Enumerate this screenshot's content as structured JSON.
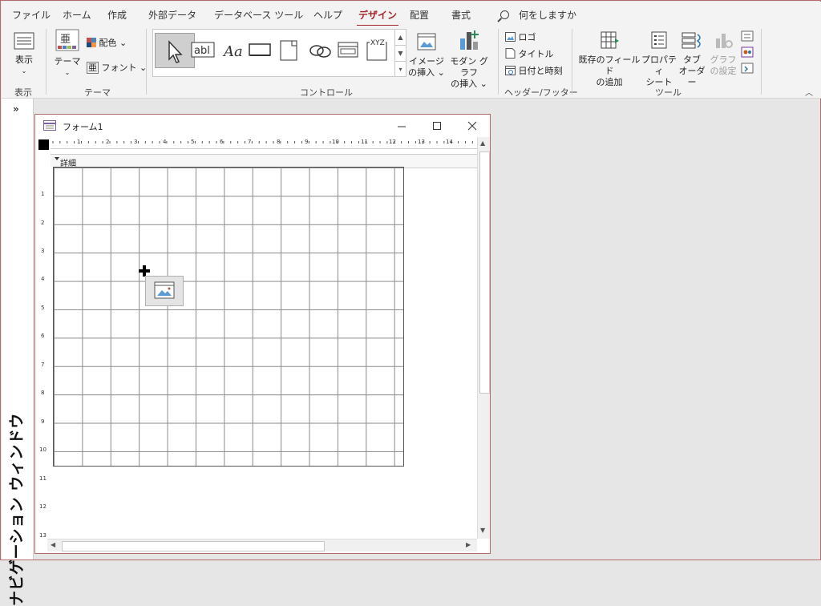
{
  "tabs": [
    {
      "id": "file",
      "label": "ファイル"
    },
    {
      "id": "home",
      "label": "ホーム"
    },
    {
      "id": "create",
      "label": "作成"
    },
    {
      "id": "external",
      "label": "外部データ"
    },
    {
      "id": "dbtools",
      "label": "データベース ツール"
    },
    {
      "id": "help",
      "label": "ヘルプ"
    },
    {
      "id": "design",
      "label": "デザイン",
      "active": true
    },
    {
      "id": "arrange",
      "label": "配置"
    },
    {
      "id": "format",
      "label": "書式"
    }
  ],
  "tell_me": "何をしますか",
  "ribbon": {
    "views": {
      "button": "表示",
      "group": "表示"
    },
    "themes": {
      "theme": "テーマ",
      "colors": "配色",
      "fonts": "フォント",
      "group": "テーマ"
    },
    "controls": {
      "group": "コントロール",
      "insert_image_1": "イメージ",
      "insert_image_2": "の挿入",
      "modern_chart_1": "モダン グラフ",
      "modern_chart_2": "の挿入"
    },
    "header_footer": {
      "logo": "ロゴ",
      "title": "タイトル",
      "datetime": "日付と時刻",
      "group": "ヘッダー/フッター"
    },
    "tools": {
      "add_fields_1": "既存のフィールド",
      "add_fields_2": "の追加",
      "property_1": "プロパティ",
      "property_2": "シート",
      "tab_order_1": "タブ",
      "tab_order_2": "オーダー",
      "chart_settings_1": "グラフ",
      "chart_settings_2": "の設定",
      "group": "ツール"
    }
  },
  "nav_pane": {
    "label": "ナビゲーション ウィンドウ"
  },
  "form": {
    "title": "フォーム1",
    "section": "詳細"
  },
  "ruler": {
    "h": [
      "1",
      "2",
      "3",
      "4",
      "5",
      "6",
      "7",
      "8",
      "9",
      "10",
      "11",
      "12",
      "13",
      "14"
    ],
    "v": [
      "1",
      "2",
      "3",
      "4",
      "5",
      "6",
      "7",
      "8",
      "9",
      "10",
      "11",
      "12",
      "13"
    ]
  },
  "colors": {
    "accent": "#a4262c"
  }
}
